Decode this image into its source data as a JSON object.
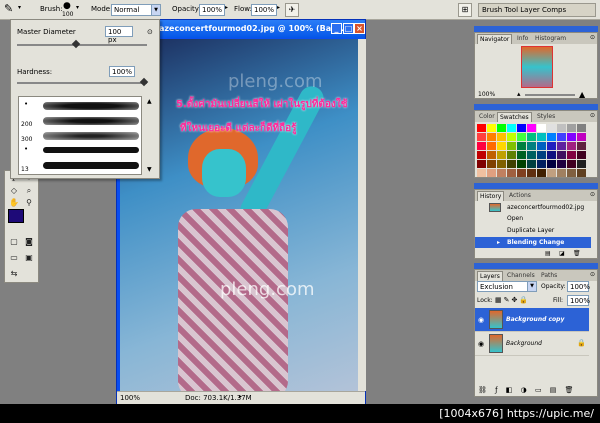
{
  "options_bar": {
    "brush_label": "Brush:",
    "brush_size": "100",
    "mode_label": "Mode:",
    "mode_value": "Normal",
    "opacity_label": "Opacity:",
    "opacity_value": "100%",
    "flow_label": "Flow:",
    "flow_value": "100%",
    "wells": [
      "Brush",
      "Tool",
      "Layer Comps"
    ]
  },
  "brush_popup": {
    "master_label": "Master Diameter",
    "master_value": "100 px",
    "hardness_label": "Hardness:",
    "hardness_value": "100%",
    "master_fraction": 0.45,
    "hardness_fraction": 0.98,
    "sizes": [
      "200",
      "300",
      "",
      "13"
    ]
  },
  "document": {
    "title": "azeconcertfourmod02.jpg @ 100% (Back...",
    "zoom": "100%",
    "doc_info": "Doc: 703.1K/1.37M",
    "watermark": "pleng.com",
    "annotation_line1": "5.ตั้งค่ามันเปลี่ยนสีให้ เผ่าในรูปที่ต้องใช้",
    "annotation_line2": "ที่ใหนเยอะดี แต่ละก็ดีที่ถือรู้"
  },
  "navigator": {
    "tabs": [
      "Navigator",
      "Info",
      "Histogram"
    ],
    "zoom": "100%"
  },
  "swatches": {
    "tabs": [
      "Color",
      "Swatches",
      "Styles"
    ],
    "colors": [
      "#ff0000",
      "#ffff00",
      "#00ff00",
      "#00ffff",
      "#0000ff",
      "#ff00ff",
      "#ffffff",
      "#e0e0e0",
      "#c0c0c0",
      "#a0a0a0",
      "#808080",
      "#ff4040",
      "#ff8000",
      "#ffc000",
      "#c0ff00",
      "#40ff40",
      "#00c080",
      "#00c0c0",
      "#0080ff",
      "#4040ff",
      "#8000ff",
      "#c000c0",
      "#ff0040",
      "#ff6a00",
      "#ffd700",
      "#80c000",
      "#008040",
      "#008080",
      "#0060c0",
      "#2020c0",
      "#6020a0",
      "#a02080",
      "#602040",
      "#c00000",
      "#c06000",
      "#c0a000",
      "#608000",
      "#006020",
      "#006060",
      "#004080",
      "#101080",
      "#401060",
      "#800040",
      "#400020",
      "#800000",
      "#804000",
      "#806000",
      "#404000",
      "#004000",
      "#004040",
      "#002060",
      "#000040",
      "#200040",
      "#400020",
      "#202020",
      "#f0c0a0",
      "#e0a080",
      "#c08060",
      "#a06040",
      "#804020",
      "#603010",
      "#402000",
      "#c0a080",
      "#a08060",
      "#806040",
      "#604020"
    ]
  },
  "history": {
    "tabs": [
      "History",
      "Actions"
    ],
    "items": [
      "Open",
      "Duplicate Layer",
      "Blending Change"
    ],
    "first_item": "azeconcertfourmod02.jpg"
  },
  "layers": {
    "tabs": [
      "Layers",
      "Channels",
      "Paths"
    ],
    "blend_mode": "Exclusion",
    "opacity_label": "Opacity:",
    "opacity_value": "100%",
    "lock_label": "Lock:",
    "fill_label": "Fill:",
    "fill_value": "100%",
    "items": [
      "Background copy",
      "Background"
    ]
  },
  "footer": {
    "text": "[1004x676] https://upic.me/"
  }
}
